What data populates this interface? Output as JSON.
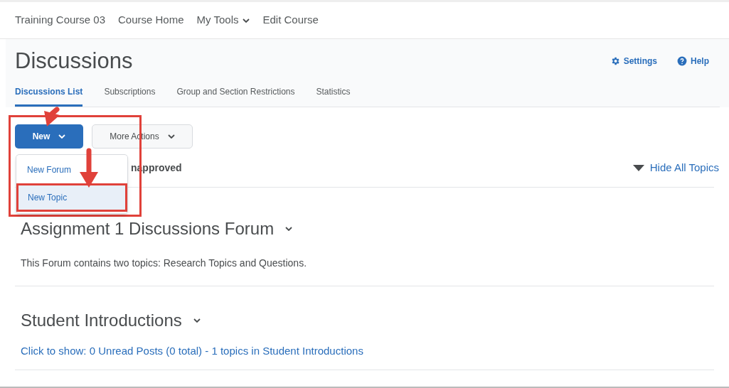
{
  "nav": {
    "items": [
      {
        "label": "Training Course 03",
        "has_menu": false
      },
      {
        "label": "Course Home",
        "has_menu": false
      },
      {
        "label": "My Tools",
        "has_menu": true
      },
      {
        "label": "Edit Course",
        "has_menu": false
      }
    ]
  },
  "header": {
    "title": "Discussions",
    "links": [
      {
        "label": "Settings",
        "kind": "settings"
      },
      {
        "label": "Help",
        "kind": "help"
      }
    ]
  },
  "tabs": [
    {
      "label": "Discussions List",
      "selected": true
    },
    {
      "label": "Subscriptions",
      "selected": false
    },
    {
      "label": "Group and Section Restrictions",
      "selected": false
    },
    {
      "label": "Statistics",
      "selected": false
    }
  ],
  "toolbar": {
    "buttons": [
      {
        "label": "New",
        "kind": "primary"
      },
      {
        "label": "More Actions",
        "kind": "secondary"
      }
    ]
  },
  "dropdown": {
    "items": [
      {
        "label": "New Forum",
        "selected": false
      },
      {
        "label": "New Topic",
        "selected": true
      }
    ]
  },
  "filter_text": "napproved",
  "hide_all": "Hide All Topics",
  "forums": [
    {
      "title": "Assignment 1 Discussions Forum",
      "description": "This Forum contains two topics:  Research Topics and Questions.",
      "kind": "text"
    },
    {
      "title": "Student Introductions",
      "description": "Click to show: 0 Unread Posts (0 total) - 1 topics in Student Introductions",
      "kind": "link"
    }
  ]
}
